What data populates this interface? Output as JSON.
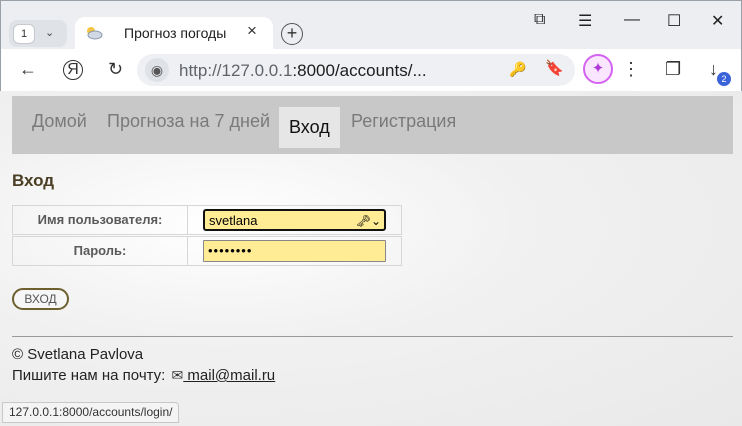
{
  "browser": {
    "tab_count": "1",
    "tab_title": "Прогноз погоды",
    "url_host": "http://127.0.0.1",
    "url_path": ":8000/accounts/...",
    "downloads_badge": "2"
  },
  "nav": {
    "items": [
      {
        "label": "Домой",
        "active": false
      },
      {
        "label": "Прогноза на 7 дней",
        "active": false
      },
      {
        "label": "Вход",
        "active": true
      },
      {
        "label": "Регистрация",
        "active": false
      }
    ]
  },
  "login": {
    "heading": "Вход",
    "username_label": "Имя пользователя:",
    "username_value": "svetlana",
    "password_label": "Пароль:",
    "password_mask": "••••••••",
    "submit_label": "ВХОД"
  },
  "footer": {
    "copyright": "© Svetlana Pavlova",
    "contact_prefix": "Пишите нам на почту:",
    "email": " mail@mail.ru"
  },
  "status_bar": "127.0.0.1:8000/accounts/login/"
}
